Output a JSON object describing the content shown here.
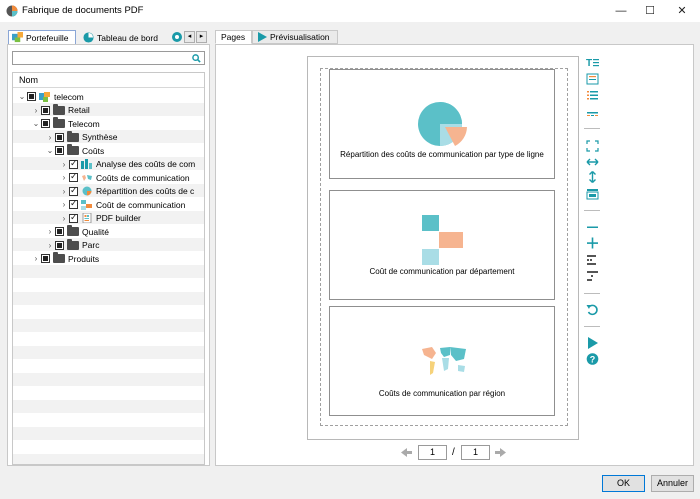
{
  "window": {
    "title": "Fabrique de documents PDF",
    "minimize": "—",
    "maximize": "☐",
    "close": "✕"
  },
  "left_panel": {
    "tabs": [
      {
        "label": "Portefeuille"
      },
      {
        "label": "Tableau de bord"
      }
    ],
    "search": {
      "value": "",
      "placeholder": ""
    },
    "tree_header": "Nom",
    "tree": [
      {
        "label": "telecom"
      },
      {
        "label": "Retail"
      },
      {
        "label": "Telecom"
      },
      {
        "label": "Synthèse"
      },
      {
        "label": "Coûts"
      },
      {
        "label": "Analyse des coûts de com"
      },
      {
        "label": "Coûts de communication"
      },
      {
        "label": "Répartition des coûts de c"
      },
      {
        "label": "Coût de communication"
      },
      {
        "label": "PDF builder"
      },
      {
        "label": "Qualité"
      },
      {
        "label": "Parc"
      },
      {
        "label": "Produits"
      }
    ]
  },
  "right_panel": {
    "tabs": [
      {
        "label": "Pages"
      },
      {
        "label": "Prévisualisation"
      }
    ],
    "cards": [
      {
        "label": "Répartition des coûts de communication par type de ligne"
      },
      {
        "label": "Coût de communication par département"
      },
      {
        "label": "Coûts de communication par région"
      }
    ],
    "pager": {
      "current": "1",
      "separator": "/",
      "total": "1"
    }
  },
  "buttons": {
    "ok": "OK",
    "cancel": "Annuler"
  },
  "colors": {
    "teal": "#5bc0c8",
    "light_teal": "#a9dde6",
    "orange": "#f6b490",
    "accent_blue": "#0078d7",
    "play_teal": "#1a9aa8"
  }
}
